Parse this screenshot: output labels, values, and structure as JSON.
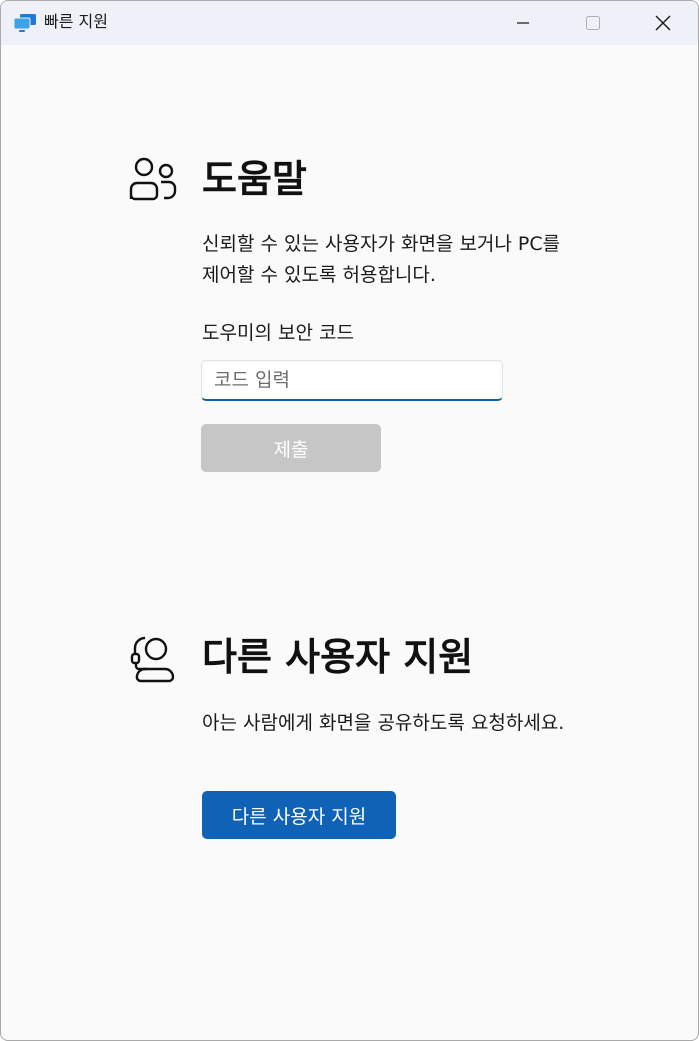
{
  "window": {
    "title": "빠른 지원"
  },
  "get_help": {
    "title": "도움말",
    "description": "신뢰할 수 있는 사용자가 화면을 보거나 PC를 제어할 수 있도록 허용합니다.",
    "code_label": "도우미의 보안 코드",
    "code_input": {
      "value": "",
      "placeholder": "코드 입력"
    },
    "submit_label": "제출"
  },
  "give_help": {
    "title": "다른 사용자 지원",
    "description": "아는 사람에게 화면을 공유하도록 요청하세요.",
    "button_label": "다른 사용자 지원"
  },
  "colors": {
    "accent": "#0f62b5",
    "input_underline": "#0f5eac",
    "disabled_button": "#c6c6c6",
    "titlebar": "#eef2f8",
    "background": "#fafafa"
  }
}
